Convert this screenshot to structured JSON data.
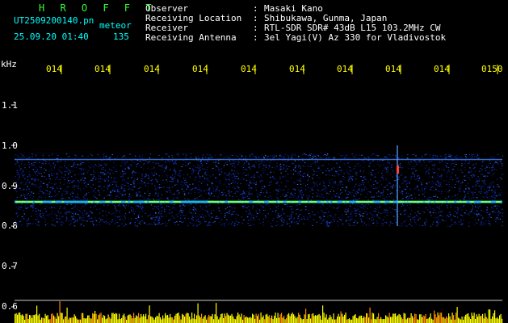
{
  "header": {
    "program_title": "H R O F F T",
    "filename": "UT2509200140.pn",
    "mode": "meteor",
    "datetime": "25.09.20 01:40",
    "count": "135",
    "info_labels": [
      "Observer",
      "Receiving Location",
      "Receiver",
      "Receiving Antenna"
    ],
    "info_colons": [
      ":",
      ":",
      ":",
      ":"
    ],
    "info_values": [
      "Masaki Kano",
      "Shibukawa, Gunma, Japan",
      "RTL-SDR SDR# 43dB L15 103.2MHz CW",
      "3el Yagi(V) Az 330 for Vladivostok"
    ]
  },
  "chart_data": {
    "type": "heatmap",
    "y_unit": "kHz",
    "y_tick_labels": [
      "1.1",
      "1.0",
      "0.9",
      "0.8",
      "0.7",
      "0.6"
    ],
    "y_ticks": [
      1.1,
      1.0,
      0.9,
      0.8,
      0.7,
      0.6
    ],
    "ylim": [
      0.6,
      1.2
    ],
    "x_tick_labels": [
      "014",
      "014",
      "014",
      "014",
      "014",
      "014",
      "014",
      "014",
      "014",
      "0150"
    ],
    "noise_band": [
      0.8,
      0.98
    ],
    "carrier_line_khz": 0.86,
    "secondary_line_khz": 0.965,
    "meteor_event_tick_index": 7,
    "colors": {
      "background": "#000000",
      "noise_low": "#0a1a8a",
      "noise_high": "#3a7cff",
      "carrier": "#7fff40",
      "spike_low": "#ffff00",
      "spike_mid": "#ff8800",
      "tick_marks": "#ffff00",
      "text": "#ffffff"
    }
  }
}
